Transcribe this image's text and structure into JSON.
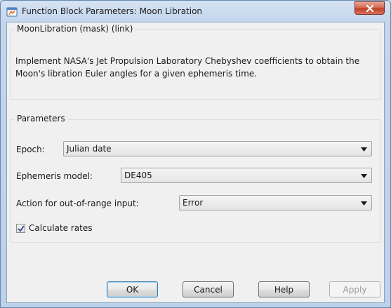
{
  "window": {
    "title": "Function Block Parameters: Moon Libration"
  },
  "mask": {
    "group_label": "MoonLibration (mask) (link)",
    "description": "Implement NASA's Jet Propulsion Laboratory Chebyshev coefficients to obtain the Moon's libration Euler angles for a given ephemeris time."
  },
  "parameters": {
    "group_label": "Parameters",
    "epoch": {
      "label": "Epoch:",
      "value": "Julian date"
    },
    "ephemeris_model": {
      "label": "Ephemeris model:",
      "value": "DE405"
    },
    "out_of_range": {
      "label": "Action for out-of-range input:",
      "value": "Error"
    },
    "calculate_rates": {
      "label": "Calculate rates",
      "checked": true
    }
  },
  "buttons": {
    "ok": "OK",
    "cancel": "Cancel",
    "help": "Help",
    "apply": "Apply"
  },
  "colors": {
    "accent": "#3c7fb1",
    "close_button": "#c1402a"
  }
}
